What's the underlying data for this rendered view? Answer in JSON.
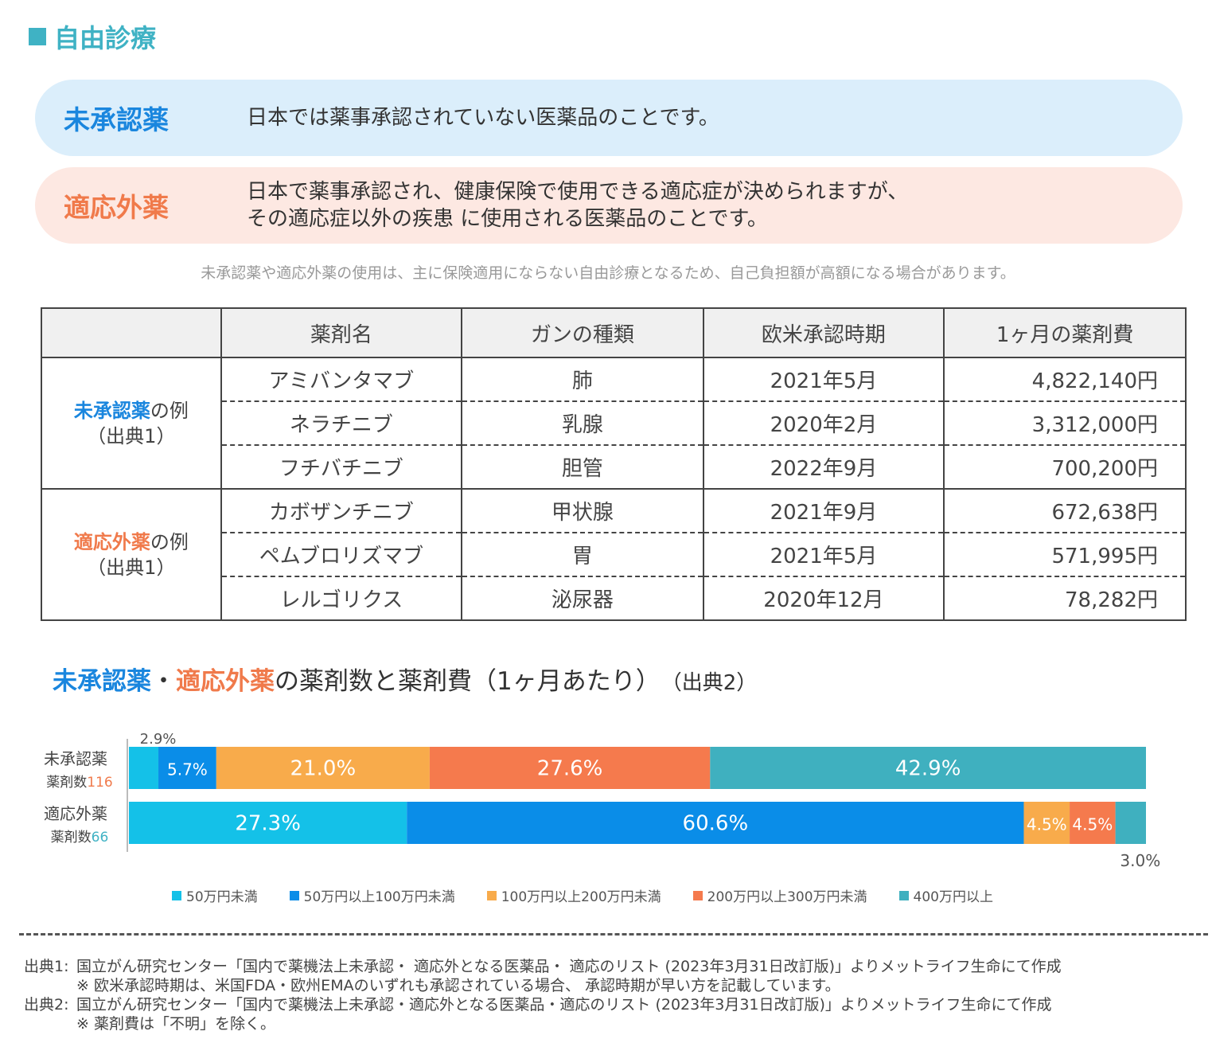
{
  "section_title": "自由診療",
  "definitions": {
    "unapproved": {
      "term": "未承認薬",
      "desc": [
        "日本では薬事承認されていない医薬品のことです。"
      ]
    },
    "offlabel": {
      "term": "適応外薬",
      "desc": [
        "日本で薬事承認され、健康保険で使用できる適応症が決められますが、",
        "その適応症以外の疾患 に使用される医薬品のことです。"
      ]
    }
  },
  "note": "未承認薬や適応外薬の使用は、主に保険適用にならない自由診療となるため、自己負担額が高額になる場合があります。",
  "table": {
    "headers": [
      "薬剤名",
      "ガンの種類",
      "欧米承認時期",
      "1ヶ月の薬剤費"
    ],
    "groups": [
      {
        "label_term": "未承認薬",
        "label_suffix": "の例",
        "label_source": "（出典1）",
        "rows": [
          [
            "アミバンタマブ",
            "肺",
            "2021年5月",
            "4,822,140円"
          ],
          [
            "ネラチニブ",
            "乳腺",
            "2020年2月",
            "3,312,000円"
          ],
          [
            "フチバチニブ",
            "胆管",
            "2022年9月",
            "700,200円"
          ]
        ]
      },
      {
        "label_term": "適応外薬",
        "label_suffix": "の例",
        "label_source": "（出典1）",
        "rows": [
          [
            "カボザンチニブ",
            "甲状腺",
            "2021年9月",
            "672,638円"
          ],
          [
            "ペムブロリズマブ",
            "胃",
            "2021年5月",
            "571,995円"
          ],
          [
            "レルゴリクス",
            "泌尿器",
            "2020年12月",
            "78,282円"
          ]
        ]
      }
    ]
  },
  "chart_title": {
    "part1": "未承認薬",
    "sep": "・",
    "part2": "適応外薬",
    "rest": "の薬剤数と薬剤費（1ヶ月あたり）",
    "source": "（出典2）"
  },
  "chart_data": {
    "type": "bar",
    "orientation": "horizontal",
    "stacked": true,
    "normalized_percent": true,
    "categories": [
      "未承認薬",
      "適応外薬"
    ],
    "category_counts_label": "薬剤数",
    "category_counts": [
      116,
      66
    ],
    "series": [
      {
        "name": "50万円未満",
        "values": [
          2.9,
          27.3
        ],
        "labels": [
          "2.9%",
          "27.3%"
        ]
      },
      {
        "name": "50万円以上100万円未満",
        "values": [
          5.7,
          60.6
        ],
        "labels": [
          "5.7%",
          "60.6%"
        ]
      },
      {
        "name": "100万円以上200万円未満",
        "values": [
          21.0,
          4.5
        ],
        "labels": [
          "21.0%",
          "4.5%"
        ]
      },
      {
        "name": "200万円以上300万円未満",
        "values": [
          27.6,
          4.5
        ],
        "labels": [
          "27.6%",
          "4.5%"
        ]
      },
      {
        "name": "400万円以上",
        "values": [
          42.9,
          3.0
        ],
        "labels": [
          "42.9%",
          "3.0%"
        ]
      }
    ],
    "colors": [
      "#14c1e8",
      "#0a8de8",
      "#f8ab4b",
      "#f57a4d",
      "#3fb0bf"
    ],
    "xlim": [
      0,
      100
    ],
    "legend_position": "bottom"
  },
  "sources": {
    "s1_label": "出典1:",
    "s1_text": "国立がん研究センター「国内で薬機法上未承認・ 適応外となる医薬品・ 適応のリスト (2023年3月31日改訂版)」よりメットライフ生命にて作成",
    "s1_note": "※ 欧米承認時期は、米国FDA・欧州EMAのいずれも承認されている場合、 承認時期が早い方を記載しています。",
    "s2_label": "出典2:",
    "s2_text": "国立がん研究センター「国内で薬機法上未承認・適応外となる医薬品・適応のリスト (2023年3月31日改訂版)」よりメットライフ生命にて作成",
    "s2_note": "※ 薬剤費は「不明」を除く。"
  }
}
